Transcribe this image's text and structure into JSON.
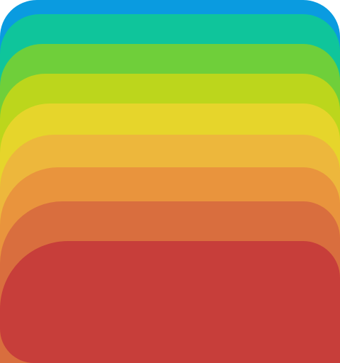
{
  "icon": {
    "bands": [
      {
        "name": "band-blue",
        "color": "#0a9be0"
      },
      {
        "name": "band-teal",
        "color": "#0fc59b"
      },
      {
        "name": "band-green",
        "color": "#6fcf3a"
      },
      {
        "name": "band-lime",
        "color": "#bcd61c"
      },
      {
        "name": "band-yellow",
        "color": "#e6d52b"
      },
      {
        "name": "band-gold",
        "color": "#edb73c"
      },
      {
        "name": "band-orange",
        "color": "#e9943d"
      },
      {
        "name": "band-dark-orange",
        "color": "#d96e3e"
      },
      {
        "name": "band-red",
        "color": "#c73e3a"
      }
    ]
  }
}
